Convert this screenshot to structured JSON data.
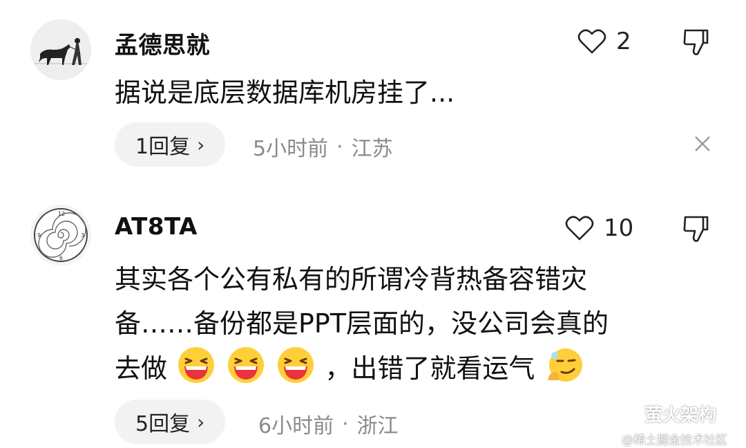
{
  "comments": [
    {
      "username": "孟德思就",
      "like_count": "2",
      "body_lines": [
        "据说是底层数据库机房挂了..."
      ],
      "reply_label": "1回复",
      "time": "5小时前",
      "separator": "·",
      "location": "江苏",
      "avatar_icon": "horse-rider-ink-painting-icon"
    },
    {
      "username": "AT8TA",
      "like_count": "10",
      "body_lines": [
        "其实各个公有私有的所谓冷背热备容错灾",
        "备……备份都是PPT层面的，没公司会真的",
        "去做",
        "，出错了就看运气"
      ],
      "reply_label": "5回复",
      "time": "6小时前",
      "separator": "·",
      "location": "浙江",
      "avatar_icon": "spiral-clock-icon"
    }
  ],
  "icons": {
    "like": "heart-outline-icon",
    "dislike": "thumbs-down-outline-icon",
    "chevron": "›",
    "close": "close-icon",
    "emoji_laugh": "grinning-laughing-emoji-icon",
    "emoji_smug": "smug-thinking-emoji-icon"
  },
  "watermark": {
    "channel": "萤火架构",
    "site": "@稀土掘金技术社区"
  }
}
